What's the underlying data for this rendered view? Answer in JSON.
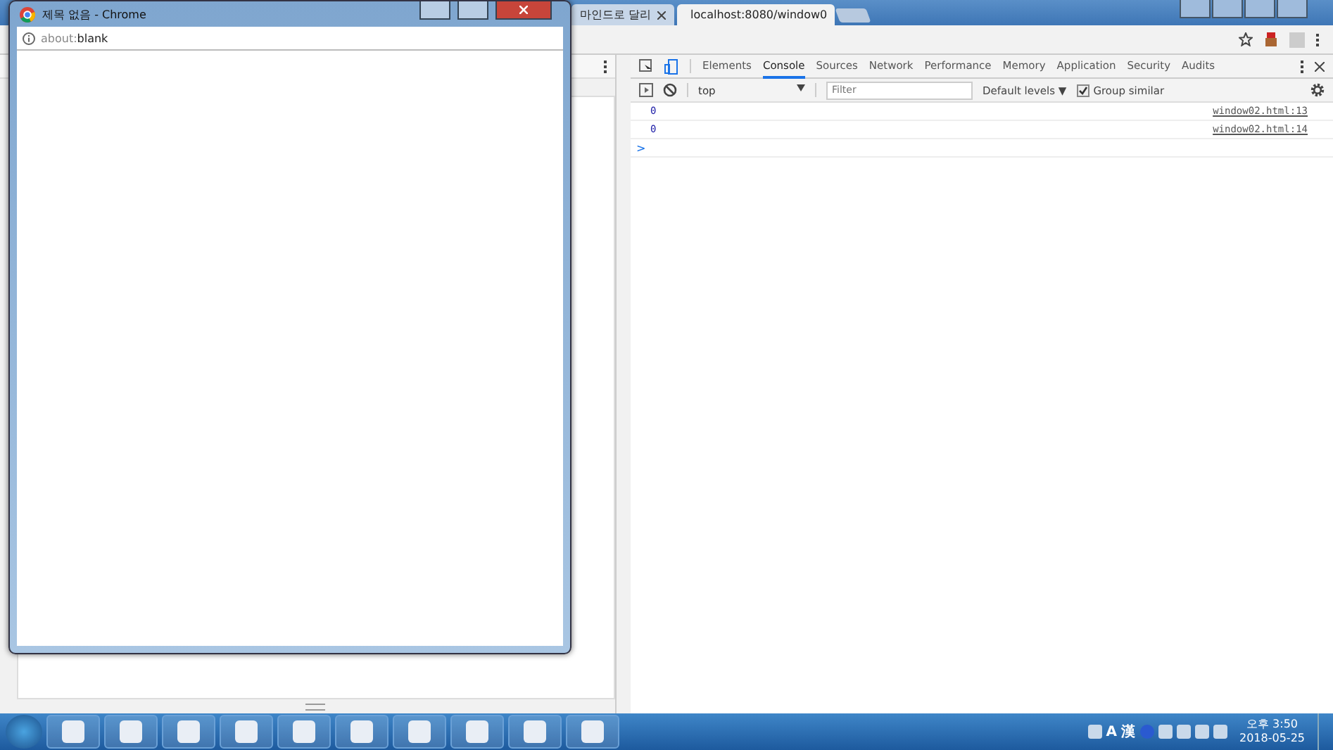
{
  "browser": {
    "tabs": [
      {
        "label": "마인드로 달리",
        "selected": false
      },
      {
        "label": "localhost:8080/window0",
        "selected": true
      }
    ]
  },
  "devtools": {
    "tabs": [
      {
        "label": "Elements",
        "selected": false
      },
      {
        "label": "Console",
        "selected": true
      },
      {
        "label": "Sources",
        "selected": false
      },
      {
        "label": "Network",
        "selected": false
      },
      {
        "label": "Performance",
        "selected": false
      },
      {
        "label": "Memory",
        "selected": false
      },
      {
        "label": "Application",
        "selected": false
      },
      {
        "label": "Security",
        "selected": false
      },
      {
        "label": "Audits",
        "selected": false
      }
    ],
    "context": "top",
    "filter_placeholder": "Filter",
    "levels": "Default levels ▼",
    "group_similar": {
      "label": "Group similar",
      "checked": true
    },
    "messages": [
      {
        "value": "0",
        "source": "window02.html:13"
      },
      {
        "value": "0",
        "source": "window02.html:14"
      }
    ],
    "prompt": ">"
  },
  "popup": {
    "title": "제목 없음 - Chrome",
    "address_prefix": "about:",
    "address_rest": "blank"
  },
  "taskbar": {
    "tray": [
      "A",
      "漢"
    ],
    "time": "오후 3:50",
    "date": "2018-05-25"
  }
}
